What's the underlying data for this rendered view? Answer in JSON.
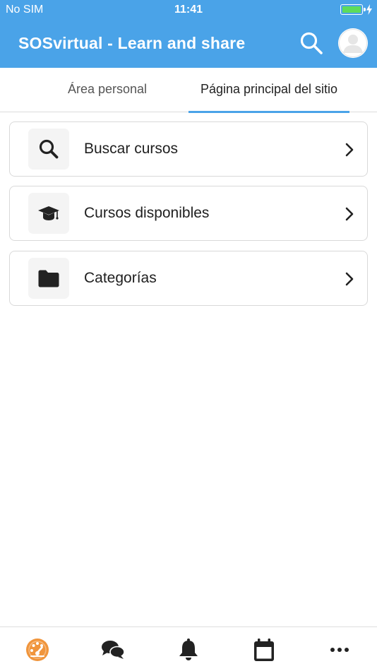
{
  "status_bar": {
    "carrier": "No SIM",
    "time": "11:41",
    "battery_level": 1.0
  },
  "header": {
    "title": "SOSvirtual - Learn and share",
    "search_icon": "search-icon",
    "avatar_icon": "user-avatar"
  },
  "tabs": [
    {
      "label": "Área personal",
      "active": false
    },
    {
      "label": "Página principal del sitio",
      "active": true
    }
  ],
  "menu": [
    {
      "label": "Buscar cursos",
      "icon": "search-icon"
    },
    {
      "label": "Cursos disponibles",
      "icon": "graduation-cap-icon"
    },
    {
      "label": "Categorías",
      "icon": "folder-icon"
    }
  ],
  "bottom_nav": [
    {
      "icon": "dashboard-icon",
      "active": true
    },
    {
      "icon": "messages-icon",
      "active": false
    },
    {
      "icon": "bell-icon",
      "active": false
    },
    {
      "icon": "calendar-icon",
      "active": false
    },
    {
      "icon": "more-icon",
      "active": false
    }
  ],
  "colors": {
    "primary": "#4aa3e8",
    "active_nav": "#f0953c",
    "icon": "#222222"
  }
}
